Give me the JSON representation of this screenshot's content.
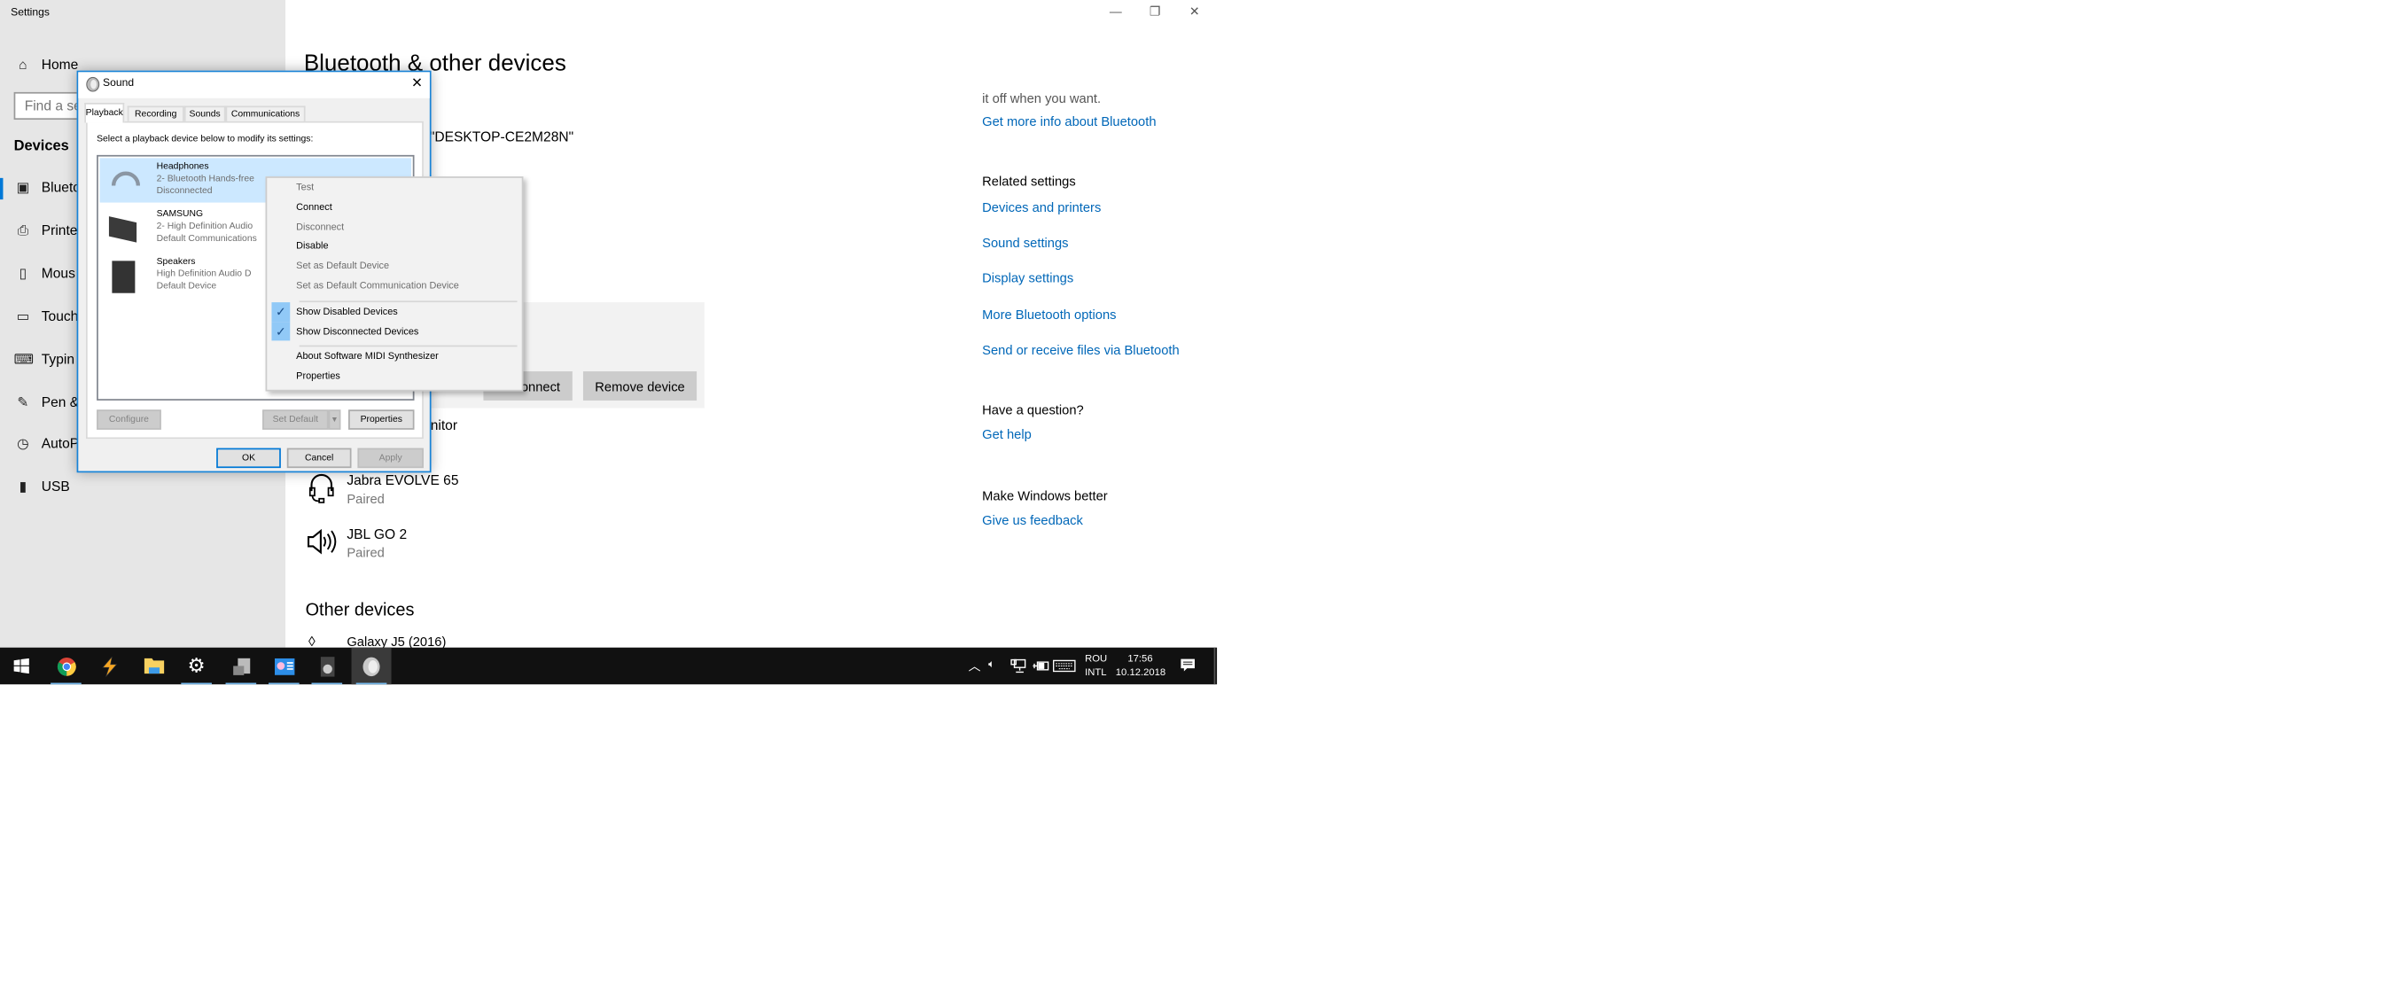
{
  "window": {
    "title": "Settings",
    "controls": {
      "minimize": "—",
      "restore": "❐",
      "close": "✕"
    }
  },
  "sidebar": {
    "home": "Home",
    "search_placeholder": "Find a se",
    "section": "Devices",
    "items": [
      {
        "label": "Blueto",
        "icon": "bluetooth-devices-icon",
        "active": true
      },
      {
        "label": "Printe",
        "icon": "printer-icon"
      },
      {
        "label": "Mous",
        "icon": "mouse-icon"
      },
      {
        "label": "Touch",
        "icon": "touchpad-icon"
      },
      {
        "label": "Typin",
        "icon": "keyboard-icon"
      },
      {
        "label": "Pen &",
        "icon": "pen-icon"
      },
      {
        "label": "AutoP",
        "icon": "autoplay-icon"
      },
      {
        "label": "USB",
        "icon": "usb-icon"
      }
    ]
  },
  "main": {
    "title": "Bluetooth & other devices",
    "discoverable": "\"DESKTOP-CE2M28N\"",
    "selected_device_buttons": {
      "disconnect": "Disconnect",
      "remove": "Remove device"
    },
    "monitor_partial": "Monitor",
    "devices": [
      {
        "name": "Jabra EVOLVE 65",
        "status": "Paired",
        "icon": "headset-icon"
      },
      {
        "name": "JBL GO 2",
        "status": "Paired",
        "icon": "speaker-icon"
      }
    ],
    "other_devices_title": "Other devices",
    "other_devices": [
      {
        "name": "Galaxy J5 (2016)",
        "icon": "phone-icon"
      }
    ]
  },
  "right": {
    "intro_tail": "it off when you want.",
    "info_link": "Get more info about Bluetooth",
    "related_title": "Related settings",
    "related_links": [
      "Devices and printers",
      "Sound settings",
      "Display settings",
      "More Bluetooth options",
      "Send or receive files via Bluetooth"
    ],
    "question_title": "Have a question?",
    "help_link": "Get help",
    "better_title": "Make Windows better",
    "feedback_link": "Give us feedback"
  },
  "sound_dialog": {
    "title": "Sound",
    "tabs": [
      "Playback",
      "Recording",
      "Sounds",
      "Communications"
    ],
    "active_tab": "Playback",
    "instruction": "Select a playback device below to modify its settings:",
    "devices": [
      {
        "name": "Headphones",
        "line2": "2- Bluetooth Hands-free",
        "line3": "Disconnected",
        "badge": "disconnected",
        "selected": true
      },
      {
        "name": "SAMSUNG",
        "line2": "2- High Definition Audio",
        "line3": "Default Communications",
        "badge": "communications"
      },
      {
        "name": "Speakers",
        "line2": "High Definition Audio D",
        "line3": "Default Device",
        "badge": "default"
      }
    ],
    "buttons": {
      "configure": "Configure",
      "set_default": "Set Default",
      "properties": "Properties",
      "ok": "OK",
      "cancel": "Cancel",
      "apply": "Apply"
    }
  },
  "context_menu": {
    "items": [
      {
        "label": "Test",
        "enabled": false
      },
      {
        "label": "Connect",
        "enabled": true
      },
      {
        "label": "Disconnect",
        "enabled": false
      },
      {
        "label": "Disable",
        "enabled": true
      },
      {
        "label": "Set as Default Device",
        "enabled": false
      },
      {
        "label": "Set as Default Communication Device",
        "enabled": false
      }
    ],
    "checked": [
      {
        "label": "Show Disabled Devices",
        "checked": true
      },
      {
        "label": "Show Disconnected Devices",
        "checked": true
      }
    ],
    "extra": [
      {
        "label": "About Software MIDI Synthesizer"
      },
      {
        "label": "Properties"
      }
    ]
  },
  "taskbar": {
    "apps": [
      "start",
      "chrome",
      "winamp",
      "file-explorer",
      "settings",
      "device-manager",
      "control-panel",
      "sound-device",
      "sound"
    ],
    "tray": {
      "language_top": "ROU",
      "language_bottom": "INTL",
      "time": "17:56",
      "date": "10.12.2018"
    }
  },
  "colors": {
    "accent": "#0078d7",
    "link": "#0067b8",
    "selection": "#cce8ff",
    "menu_check": "#91c9f7"
  }
}
